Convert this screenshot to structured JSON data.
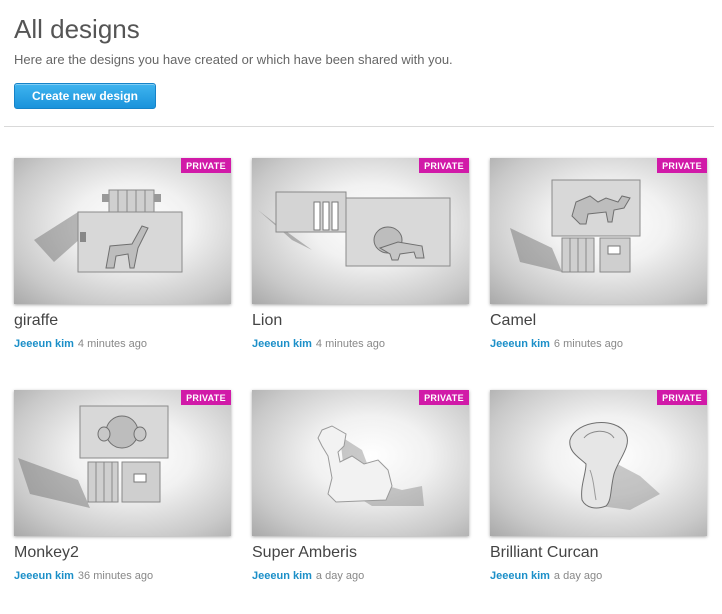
{
  "page": {
    "title": "All designs",
    "subtitle": "Here are the designs you have created or which have been shared with you.",
    "create_label": "Create new design"
  },
  "designs": [
    {
      "name": "giraffe",
      "badge": "PRIVATE",
      "author": "Jeeeun kim",
      "time": "4 minutes ago",
      "thumbnail": "giraffe-kit-model"
    },
    {
      "name": "Lion",
      "badge": "PRIVATE",
      "author": "Jeeeun kim",
      "time": "4 minutes ago",
      "thumbnail": "lion-kit-model"
    },
    {
      "name": "Camel",
      "badge": "PRIVATE",
      "author": "Jeeeun kim",
      "time": "6 minutes ago",
      "thumbnail": "camel-kit-model"
    },
    {
      "name": "Monkey2",
      "badge": "PRIVATE",
      "author": "Jeeeun kim",
      "time": "36 minutes ago",
      "thumbnail": "monkey-kit-model"
    },
    {
      "name": "Super Amberis",
      "badge": "PRIVATE",
      "author": "Jeeeun kim",
      "time": "a day ago",
      "thumbnail": "camel-silhouette-model"
    },
    {
      "name": "Brilliant Curcan",
      "badge": "PRIVATE",
      "author": "Jeeeun kim",
      "time": "a day ago",
      "thumbnail": "cobra-model"
    }
  ],
  "colors": {
    "accent": "#1b8fc8",
    "button": "#1a93db",
    "private_badge": "#d11aa8"
  }
}
